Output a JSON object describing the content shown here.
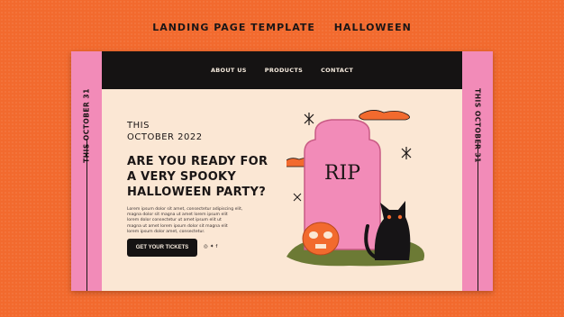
{
  "page_header": {
    "left": "LANDING PAGE TEMPLATE",
    "right": "HALLOWEEN"
  },
  "side_left_text": "THIS OCTOBER 31",
  "side_right_text": "THIS OCTOBER 31",
  "nav": {
    "items": [
      "ABOUT US",
      "PRODUCTS",
      "CONTACT"
    ]
  },
  "hero": {
    "subtitle_line1": "THIS",
    "subtitle_line2": "OCTOBER 2022",
    "headline_line1": "ARE YOU READY FOR",
    "headline_line2": "A VERY SPOOKY",
    "headline_line3": "HALLOWEEN PARTY?",
    "body_lines": [
      "Lorem ipsum dolor sit amet, consectetur adipiscing elit,",
      "magna dolor sit magna ut amet lorem ipsum elit",
      "lorem dolor consectetur ut amet ipsum elit ut",
      "magna ut amet lorem ipsum dolor sit magna elit",
      "lorem ipsum dolor amet, consectetur."
    ],
    "cta_label": "GET YOUR TICKETS",
    "socials": [
      "instagram-icon",
      "twitter-icon",
      "facebook-icon"
    ]
  },
  "illustration": {
    "tombstone_text": "RIP",
    "colors": {
      "tombstone": "#f28bb8",
      "pumpkin": "#f26a2e",
      "cat": "#161416",
      "grass": "#6c7a35"
    }
  },
  "colors": {
    "background": "#f26a2e",
    "frame": "#fbe7d4",
    "side": "#f28bb8",
    "nav": "#151313"
  }
}
